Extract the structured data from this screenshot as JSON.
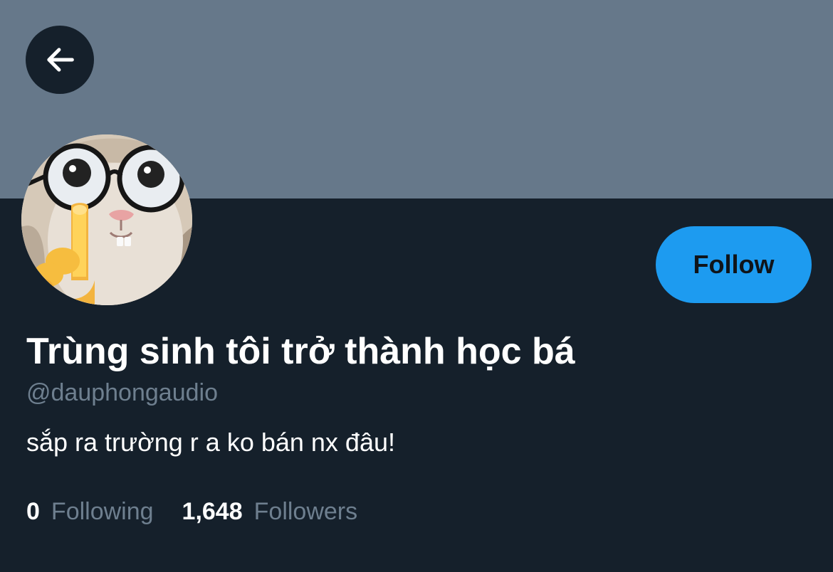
{
  "profile": {
    "display_name": "Trùng sinh tôi trở thành học bá",
    "username": "@dauphongaudio",
    "bio": "sắp ra trường r a ko bán nx đâu!",
    "banner_color": "#66788a",
    "avatar_icon": "cat-with-glasses-avatar"
  },
  "header": {
    "back_icon": "arrow-left-icon"
  },
  "actions": {
    "follow_label": "Follow",
    "follow_color": "#1d9bf0"
  },
  "stats": {
    "following_count": "0",
    "following_label": "Following",
    "followers_count": "1,648",
    "followers_label": "Followers"
  },
  "theme": {
    "background": "#15202b",
    "primary_text": "#ffffff",
    "secondary_text": "#6e7f8f"
  }
}
